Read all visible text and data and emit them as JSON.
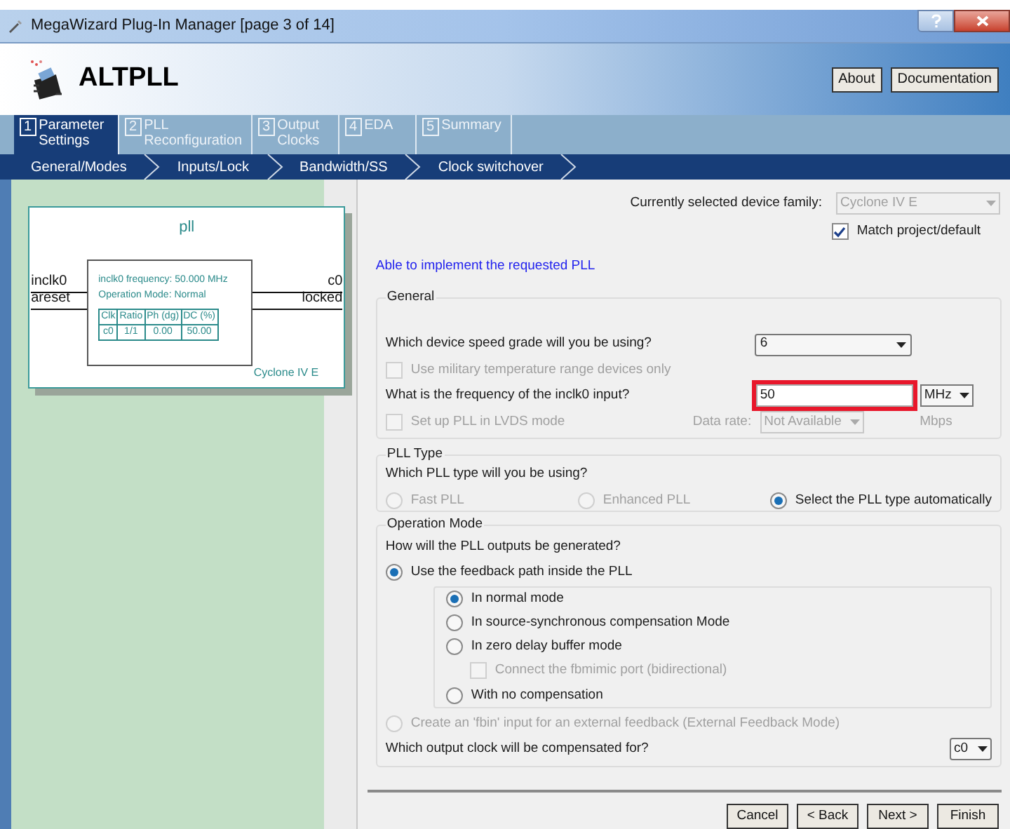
{
  "window": {
    "title": "MegaWizard Plug-In Manager [page 3 of 14]"
  },
  "header": {
    "title": "ALTPLL",
    "buttons": [
      "About",
      "Documentation"
    ]
  },
  "tabs": [
    {
      "number": "1",
      "label": "Parameter Settings",
      "selected": true
    },
    {
      "number": "2",
      "label": "PLL Reconfiguration",
      "selected": false
    },
    {
      "number": "3",
      "label": "Output Clocks",
      "selected": false
    },
    {
      "number": "4",
      "label": "EDA",
      "selected": false
    },
    {
      "number": "5",
      "label": "Summary",
      "selected": false
    }
  ],
  "subtabs": [
    "General/Modes",
    "Inputs/Lock",
    "Bandwidth/SS",
    "Clock switchover"
  ],
  "diagram": {
    "title": "pll",
    "inputs": [
      "inclk0",
      "areset"
    ],
    "outputs": [
      "c0",
      "locked"
    ],
    "info": [
      "inclk0 frequency: 50.000 MHz",
      "Operation Mode: Normal"
    ],
    "columns": [
      "Clk",
      "Ratio",
      "Ph (dg)",
      "DC (%)"
    ],
    "rows": [
      [
        "c0",
        "1/1",
        "0.00",
        "50.00"
      ]
    ],
    "device": "Cyclone IV E"
  },
  "device_family": {
    "label": "Currently selected device family:",
    "value": "Cyclone IV E",
    "disabled": true,
    "match": {
      "label": "Match project/default",
      "checked": true
    }
  },
  "status": "Able to implement the requested PLL",
  "general": {
    "title": "General",
    "speed_grade": {
      "label": "Which device speed grade will you be using?",
      "value": "6"
    },
    "military": {
      "label": "Use military temperature range devices only",
      "checked": false,
      "disabled": true
    },
    "frequency": {
      "label": "What is the frequency of the inclk0 input?",
      "value": "50",
      "unit": "MHz",
      "highlighted": true
    },
    "lvds": {
      "label": "Set up PLL in LVDS mode",
      "checked": false,
      "disabled": true
    },
    "data_rate": {
      "label": "Data rate:",
      "value": "Not Available",
      "unit": "Mbps",
      "disabled": true
    }
  },
  "pll_type": {
    "title": "PLL Type",
    "question": "Which PLL type will you be using?",
    "options": [
      {
        "label": "Fast PLL",
        "selected": false,
        "disabled": true
      },
      {
        "label": "Enhanced PLL",
        "selected": false,
        "disabled": true
      },
      {
        "label": "Select the PLL type automatically",
        "selected": true,
        "disabled": false
      }
    ]
  },
  "operation_mode": {
    "title": "Operation Mode",
    "question": "How will the PLL outputs be generated?",
    "options": [
      {
        "label": "Use the feedback path inside the PLL",
        "selected": true,
        "disabled": false,
        "children": [
          {
            "kind": "radio",
            "label": "In normal mode",
            "selected": true,
            "disabled": false
          },
          {
            "kind": "radio",
            "label": "In source-synchronous compensation Mode",
            "selected": false,
            "disabled": false
          },
          {
            "kind": "radio",
            "label": "In zero delay buffer mode",
            "selected": false,
            "disabled": false
          },
          {
            "kind": "checkbox",
            "label": "Connect the fbmimic port (bidirectional)",
            "checked": false,
            "disabled": true
          },
          {
            "kind": "radio",
            "label": "With no compensation",
            "selected": false,
            "disabled": false
          }
        ]
      },
      {
        "label": "Create an 'fbin' input for an external feedback (External Feedback Mode)",
        "selected": false,
        "disabled": true
      }
    ],
    "compensate": {
      "label": "Which output clock will be compensated for?",
      "value": "c0"
    }
  },
  "footer": {
    "buttons": [
      "Cancel",
      "< Back",
      "Next >",
      "Finish"
    ]
  }
}
